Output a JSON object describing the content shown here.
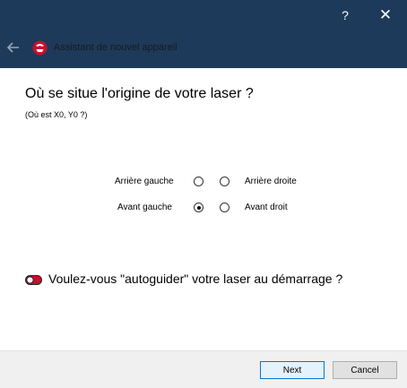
{
  "window": {
    "title": "Assistant de nouvel appareil",
    "help_glyph": "?",
    "close_glyph": "✕",
    "titlebar_color": "#1d3a5b"
  },
  "icons": {
    "back": "arrow-left-icon",
    "app": "lightburn-app-icon",
    "toggle": "toggle-switch-icon"
  },
  "question": {
    "title": "Où se situe l'origine de votre laser ?",
    "subtitle": "(Où est X0, Y0 ?)"
  },
  "origin_options": [
    {
      "label": "Arrière gauche",
      "selected": false
    },
    {
      "label": "Arrière droite",
      "selected": false
    },
    {
      "label": "Avant gauche",
      "selected": true
    },
    {
      "label": "Avant droit",
      "selected": false
    }
  ],
  "autohome": {
    "label": "Voulez-vous \"autoguider\" votre laser au démarrage ?",
    "enabled": false,
    "toggle_color": "#c8102e"
  },
  "footer": {
    "next_label": "Next",
    "cancel_label": "Cancel"
  }
}
